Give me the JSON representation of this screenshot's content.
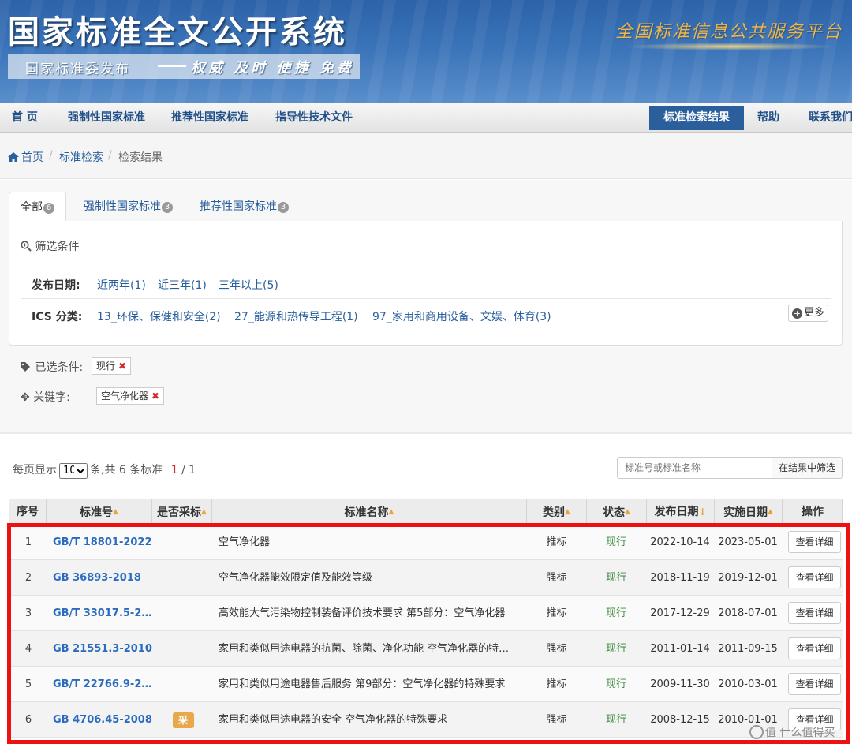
{
  "header": {
    "site_title": "国家标准全文公开系统",
    "subtitle_left": "国家标准委发布",
    "subtitle_right": "权威 及时 便捷 免费",
    "platform_name": "全国标准信息公共服务平台"
  },
  "nav": {
    "items": [
      {
        "label": "首 页"
      },
      {
        "label": "强制性国家标准"
      },
      {
        "label": "推荐性国家标准"
      },
      {
        "label": "指导性技术文件"
      },
      {
        "label": "标准检索结果"
      },
      {
        "label": "帮助"
      },
      {
        "label": "联系我们"
      }
    ],
    "active": "标准检索结果"
  },
  "breadcrumb": {
    "home": "首页",
    "search": "标准检索",
    "current": "检索结果",
    "separator": "/"
  },
  "tabs": [
    {
      "label": "全部",
      "count": "6"
    },
    {
      "label": "强制性国家标准",
      "count": "3"
    },
    {
      "label": "推荐性国家标准",
      "count": "3"
    }
  ],
  "filters": {
    "title": "筛选条件",
    "publish_date": {
      "label": "发布日期:",
      "options": [
        "近两年(1)",
        "近三年(1)",
        "三年以上(5)"
      ]
    },
    "ics": {
      "label": "ICS 分类:",
      "options": [
        "13_环保、保健和安全(2)",
        "27_能源和热传导工程(1)",
        "97_家用和商用设备、文娱、体育(3)"
      ],
      "more": "更多"
    }
  },
  "selected": {
    "conditions_label": "已选条件:",
    "condition_chip": "现行",
    "keyword_label": "关键字:",
    "keyword_chip": "空气净化器"
  },
  "pager": {
    "prefix": "每页显示",
    "page_size": "10",
    "summary": "条,共 6 条标准",
    "current_page": "1",
    "total_pages": "/ 1"
  },
  "search": {
    "placeholder": "标准号或标准名称",
    "button": "在结果中筛选"
  },
  "table": {
    "headers": [
      "序号",
      "标准号",
      "是否采标",
      "标准名称",
      "类别",
      "状态",
      "发布日期",
      "实施日期",
      "操作"
    ],
    "rows": [
      {
        "seq": "1",
        "code": "GB/T 18801-2022",
        "adopt": "",
        "name": "空气净化器",
        "type": "推标",
        "status": "现行",
        "pub": "2022-10-14",
        "imp": "2023-05-01",
        "op": "查看详细"
      },
      {
        "seq": "2",
        "code": "GB 36893-2018",
        "adopt": "",
        "name": "空气净化器能效限定值及能效等级",
        "type": "强标",
        "status": "现行",
        "pub": "2018-11-19",
        "imp": "2019-12-01",
        "op": "查看详细"
      },
      {
        "seq": "3",
        "code": "GB/T 33017.5-20…",
        "adopt": "",
        "name": "高效能大气污染物控制装备评价技术要求 第5部分：空气净化器",
        "type": "推标",
        "status": "现行",
        "pub": "2017-12-29",
        "imp": "2018-07-01",
        "op": "查看详细"
      },
      {
        "seq": "4",
        "code": "GB 21551.3-2010",
        "adopt": "",
        "name": "家用和类似用途电器的抗菌、除菌、净化功能 空气净化器的特…",
        "type": "强标",
        "status": "现行",
        "pub": "2011-01-14",
        "imp": "2011-09-15",
        "op": "查看详细"
      },
      {
        "seq": "5",
        "code": "GB/T 22766.9-20…",
        "adopt": "",
        "name": "家用和类似用途电器售后服务 第9部分：空气净化器的特殊要求",
        "type": "推标",
        "status": "现行",
        "pub": "2009-11-30",
        "imp": "2010-03-01",
        "op": "查看详细"
      },
      {
        "seq": "6",
        "code": "GB 4706.45-2008",
        "adopt": "采",
        "name": "家用和类似用途电器的安全 空气净化器的特殊要求",
        "type": "强标",
        "status": "现行",
        "pub": "2008-12-15",
        "imp": "2010-01-01",
        "op": "查看详细"
      }
    ]
  },
  "watermark": "值 什么值得买",
  "colors": {
    "brand_blue": "#2b5f9c",
    "link_blue": "#2a5f9e",
    "status_green": "#3a8a3a",
    "highlight_red": "#ee1111",
    "adopt_orange": "#e8a94c",
    "platform_gold": "#f1b645"
  }
}
